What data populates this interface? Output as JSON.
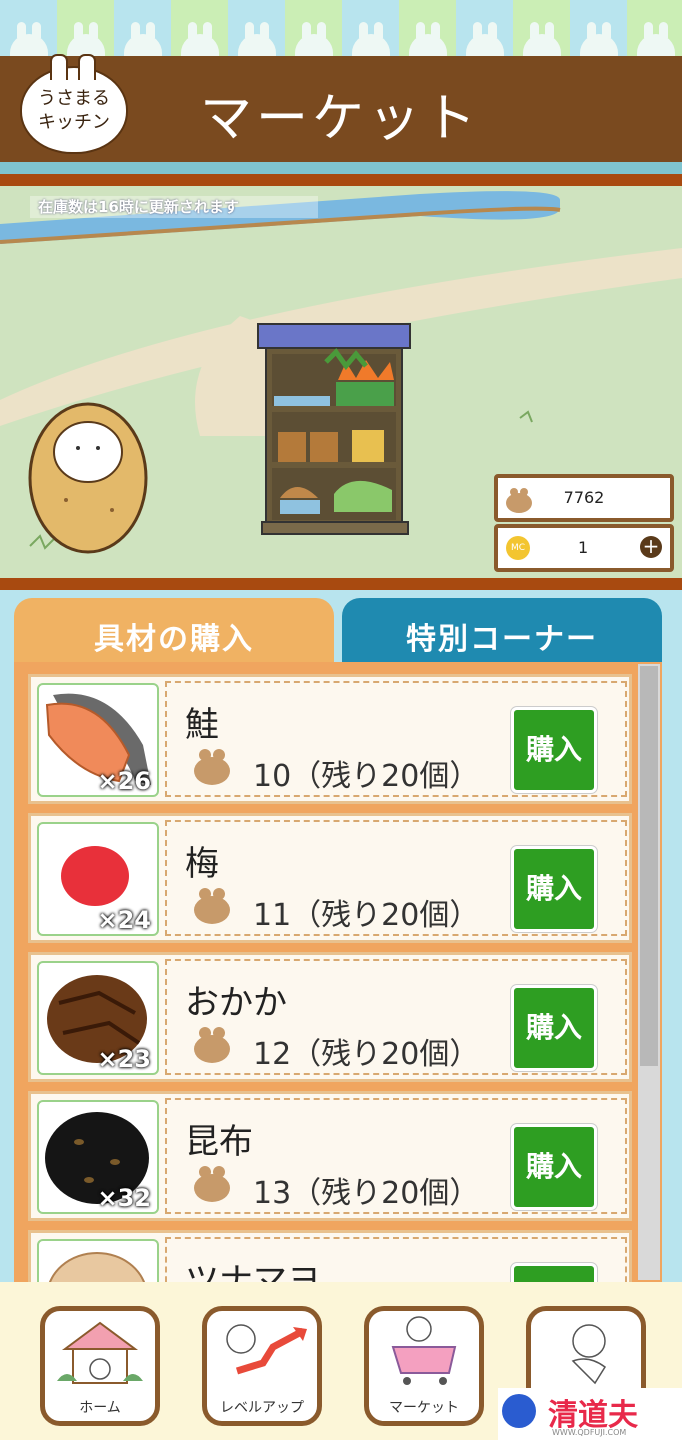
{
  "header": {
    "logo_line1": "うさまる",
    "logo_line2": "キッチン",
    "title": "マーケット"
  },
  "notice": "在庫数は16時に更新されます",
  "stats": {
    "coins": "7762",
    "mc": "1",
    "mc_icon_label": "MC"
  },
  "tabs": [
    {
      "label": "具材の購入"
    },
    {
      "label": "特別コーナー"
    }
  ],
  "items": [
    {
      "name": "鮭",
      "price": "10（残り20個）",
      "count": "×26",
      "buy": "購入"
    },
    {
      "name": "梅",
      "price": "11（残り20個）",
      "count": "×24",
      "buy": "購入"
    },
    {
      "name": "おかか",
      "price": "12（残り20個）",
      "count": "×23",
      "buy": "購入"
    },
    {
      "name": "昆布",
      "price": "13（残り20個）",
      "count": "×32",
      "buy": "購入"
    },
    {
      "name": "ツナマヨ",
      "price": "",
      "count": "",
      "buy": "購入"
    }
  ],
  "nav": [
    {
      "label": "ホーム"
    },
    {
      "label": "レベルアップ"
    },
    {
      "label": "マーケット"
    },
    {
      "label": ""
    }
  ],
  "watermark": {
    "text": "清道夫",
    "sub": "WWW.QDFUJI.COM"
  },
  "colors": {
    "header_brown": "#7a4a1f",
    "tab_orange": "#f0b263",
    "tab_blue": "#1f8ab0",
    "buy_green": "#2e9e22"
  }
}
